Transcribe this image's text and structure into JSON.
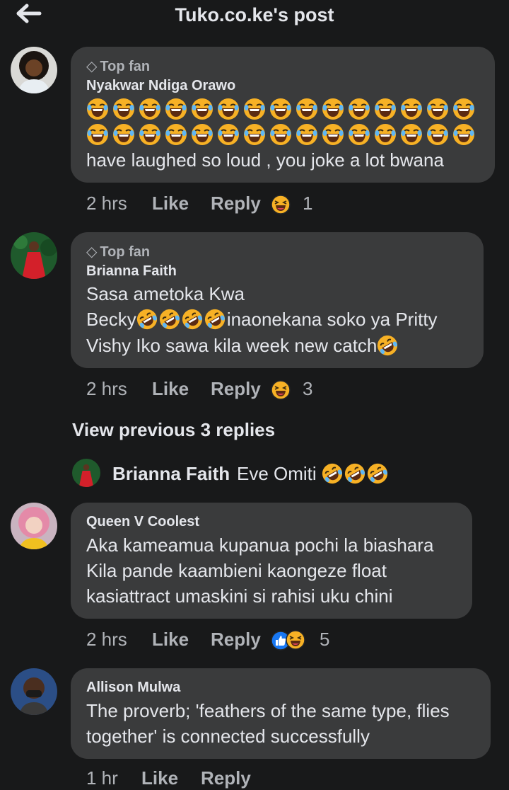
{
  "header": {
    "title": "Tuko.co.ke's post"
  },
  "comments": [
    {
      "badge": "Top fan",
      "author": "Nyakwar Ndiga Orawo",
      "emoji_line_count": 15,
      "text": "have laughed so loud , you joke a lot bwana",
      "time": "2 hrs",
      "like": "Like",
      "reply": "Reply",
      "reactions": "1"
    },
    {
      "badge": "Top fan",
      "author": "Brianna Faith",
      "line1": "Sasa ametoka Kwa",
      "line2_a": "Becky",
      "line2_b": "inaonekana soko ya Pritty",
      "line3": "Vishy Iko sawa kila week new catch",
      "time": "2 hrs",
      "like": "Like",
      "reply": "Reply",
      "reactions": "3"
    },
    {
      "author": "Queen V Coolest",
      "line1": "Aka kameamua kupanua pochi la biashara",
      "line2": "Kila pande kaambieni kaongeze float",
      "line3": "kasiattract umaskini si rahisi uku chini",
      "time": "2 hrs",
      "like": "Like",
      "reply": "Reply",
      "reactions": "5"
    },
    {
      "author": "Allison Mulwa",
      "line1": "The proverb; 'feathers of the same type, flies",
      "line2": "together' is connected successfully",
      "time": "1 hr",
      "like": "Like",
      "reply": "Reply"
    }
  ],
  "view_previous": "View previous 3 replies",
  "reply_preview": {
    "author": "Brianna Faith",
    "text": "Eve Omiti"
  },
  "icons": {
    "back": "arrow-left-icon",
    "top_fan": "diamond-icon",
    "laugh": "laughing-emoji",
    "rofl": "rofl-emoji",
    "like": "like-thumb-icon"
  },
  "colors": {
    "background": "#18191a",
    "bubble": "#3a3b3c",
    "secondary_text": "#b0b3b8",
    "like_blue": "#1877f2",
    "emoji_yellow": "#f7b125"
  }
}
